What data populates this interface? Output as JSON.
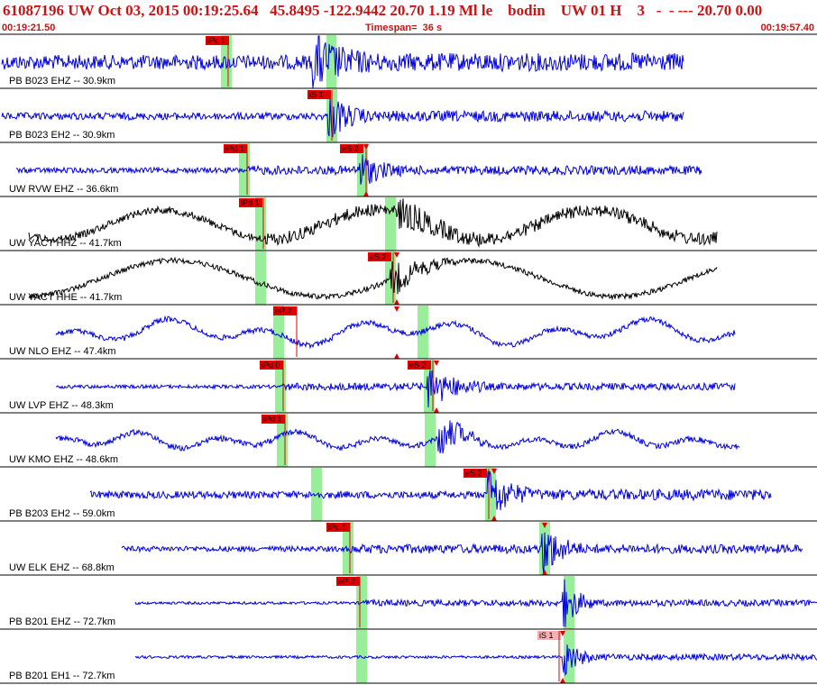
{
  "header": {
    "title": "61087196 UW Oct 03, 2015 00:19:25.64   45.8495 -122.9442 20.70 1.19 Ml le    bodin    UW 01 H    3   -  - --- 20.70 0.00",
    "start_time": "00:19:21.50",
    "timespan": "Timespan=  36 s",
    "end_time": "00:19:57.40"
  },
  "colors": {
    "title": "#c81414",
    "trace_blue": "#0000dd",
    "trace_black": "#000000",
    "pick_red": "#e00000",
    "pick_pink": "#f4b0b0",
    "window_green": "#99ee99"
  },
  "traces": [
    {
      "label": "PB B023 EHZ -- 30.9km",
      "color": "blue",
      "picks": [
        {
          "text": "iPc 1",
          "style": "red"
        }
      ]
    },
    {
      "label": "PB B023 EH2 -- 30.9km",
      "color": "blue",
      "picks": [
        {
          "text": "iS 1",
          "style": "red"
        }
      ]
    },
    {
      "label": "UW RVW EHZ -- 36.6km",
      "color": "blue",
      "picks": [
        {
          "text": "iPd 1",
          "style": "red"
        },
        {
          "text": "eS 2",
          "style": "red"
        }
      ]
    },
    {
      "label": "UW YACT HHZ -- 41.7km",
      "color": "black",
      "picks": [
        {
          "text": "iPd 1",
          "style": "red"
        }
      ]
    },
    {
      "label": "UW YACT HHE -- 41.7km",
      "color": "black",
      "picks": [
        {
          "text": "eS 2",
          "style": "red"
        }
      ]
    },
    {
      "label": "UW NLO EHZ -- 47.4km",
      "color": "blue",
      "picks": [
        {
          "text": "eP 2",
          "style": "red"
        }
      ]
    },
    {
      "label": "UW LVP EHZ -- 48.3km",
      "color": "blue",
      "picks": [
        {
          "text": "iPd 0",
          "style": "red"
        },
        {
          "text": "eS 2",
          "style": "red"
        }
      ]
    },
    {
      "label": "UW KMO EHZ -- 48.6km",
      "color": "blue",
      "picks": [
        {
          "text": "iPd 1",
          "style": "red"
        }
      ]
    },
    {
      "label": "PB B203 EH2 -- 59.0km",
      "color": "blue",
      "picks": [
        {
          "text": "eS 2",
          "style": "red"
        }
      ]
    },
    {
      "label": "UW ELK EHZ -- 68.8km",
      "color": "blue",
      "picks": [
        {
          "text": "iPc 1",
          "style": "red"
        }
      ]
    },
    {
      "label": "PB B201 EHZ -- 72.7km",
      "color": "blue",
      "picks": [
        {
          "text": "eP 2",
          "style": "red"
        }
      ]
    },
    {
      "label": "PB B201 EH1 -- 72.7km",
      "color": "blue",
      "picks": [
        {
          "text": "iS 1",
          "style": "pink"
        }
      ]
    }
  ]
}
